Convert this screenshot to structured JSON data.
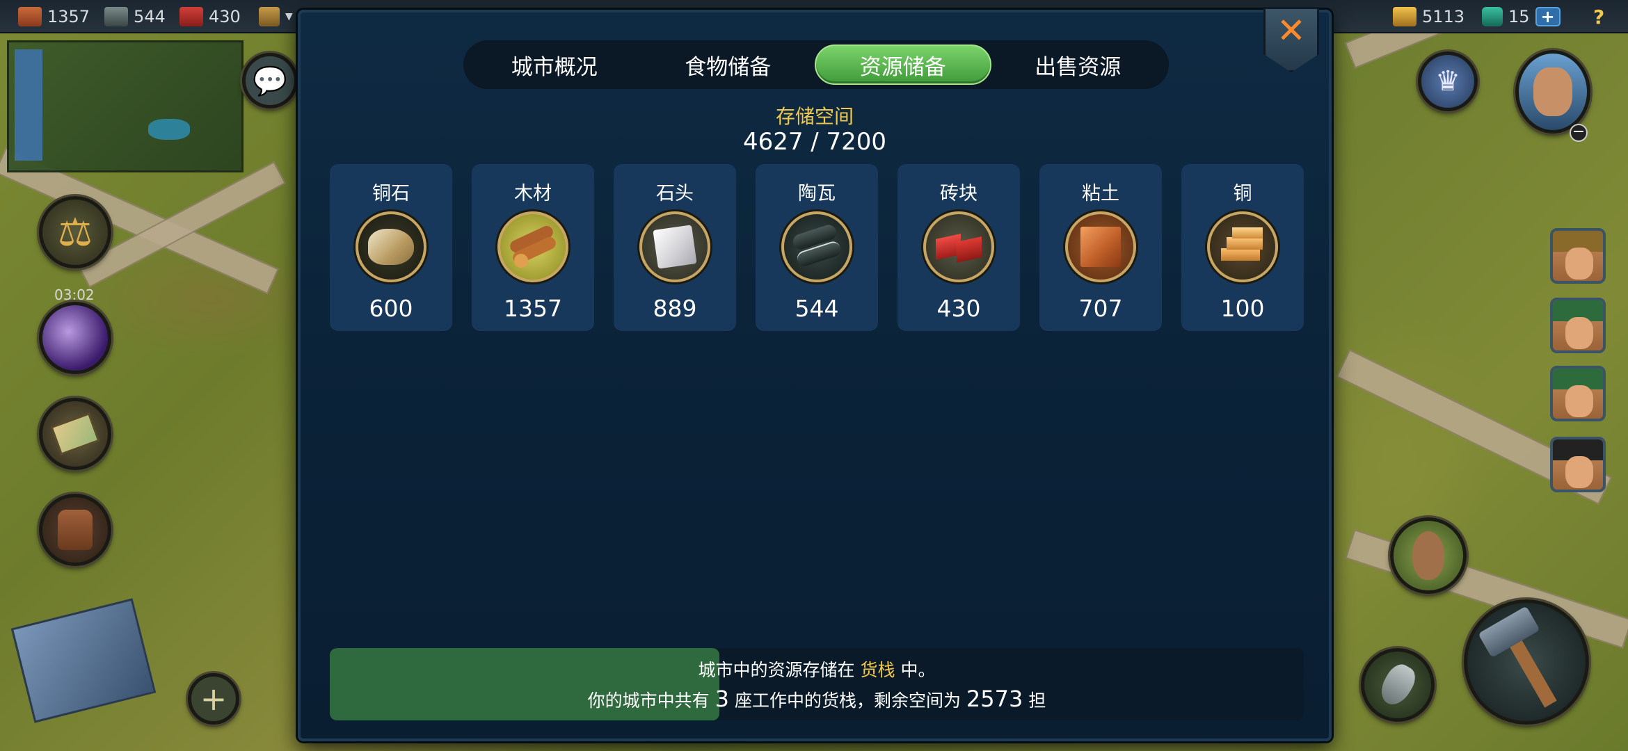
{
  "topbar": {
    "left": [
      {
        "icon": "brick-icon",
        "value": "1357"
      },
      {
        "icon": "stone-icon",
        "value": "544"
      },
      {
        "icon": "clay-icon",
        "value": "430"
      }
    ],
    "right": [
      {
        "icon": "gold-icon",
        "value": "5113"
      },
      {
        "icon": "gem-icon",
        "value": "15"
      }
    ],
    "plus_label": "+",
    "help_label": "?"
  },
  "left_panel": {
    "timer": "03:02"
  },
  "dialog": {
    "tabs": [
      {
        "label": "城市概况",
        "active": false
      },
      {
        "label": "食物储备",
        "active": false
      },
      {
        "label": "资源储备",
        "active": true
      },
      {
        "label": "出售资源",
        "active": false
      }
    ],
    "close_label": "✕",
    "storage_title": "存储空间",
    "storage_value": "4627 / 7200",
    "resources": [
      {
        "name": "铜石",
        "qty": "600",
        "icon": "copper-ore-icon"
      },
      {
        "name": "木材",
        "qty": "1357",
        "icon": "wood-icon"
      },
      {
        "name": "石头",
        "qty": "889",
        "icon": "stone-icon"
      },
      {
        "name": "陶瓦",
        "qty": "544",
        "icon": "tile-icon"
      },
      {
        "name": "砖块",
        "qty": "430",
        "icon": "brick-icon"
      },
      {
        "name": "粘土",
        "qty": "707",
        "icon": "clay-icon"
      },
      {
        "name": "铜",
        "qty": "100",
        "icon": "copper-icon"
      }
    ],
    "info": {
      "line1_a": "城市中的资源存储在",
      "line1_hl": "货栈",
      "line1_b": "中。",
      "line2_a": "你的城市中共有",
      "line2_num": "3",
      "line2_b": "座工作中的货栈，剩余空间为",
      "line2_space": "2573",
      "line2_unit": "担"
    }
  }
}
